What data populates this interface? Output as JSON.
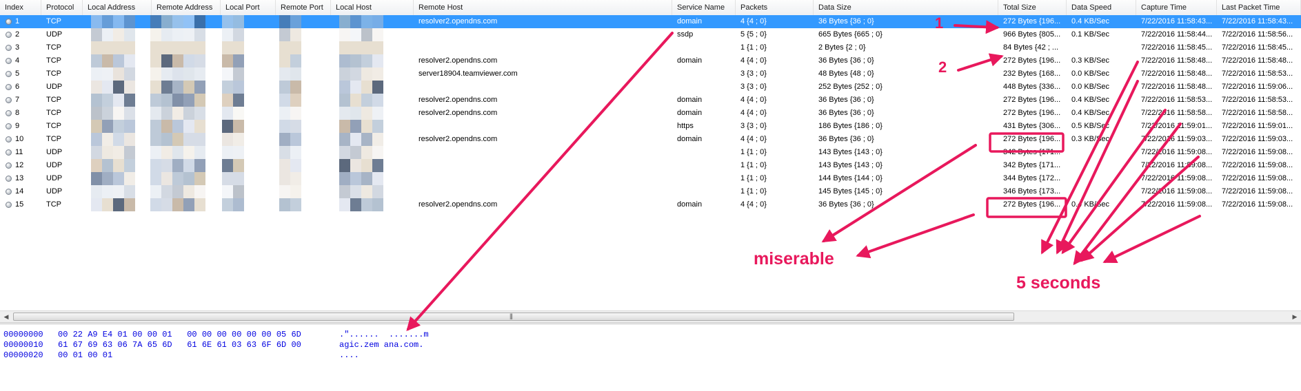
{
  "columns": [
    "Index",
    "Protocol",
    "Local Address",
    "Remote Address",
    "Local Port",
    "Remote Port",
    "Local Host",
    "Remote Host",
    "Service Name",
    "Packets",
    "Data Size",
    "Total Size",
    "Data Speed",
    "Capture Time",
    "Last Packet Time"
  ],
  "rows": [
    {
      "index": "1",
      "protocol": "TCP",
      "remote_host": "resolver2.opendns.com",
      "service": "domain",
      "packets": "4  {4 ; 0}",
      "data_size": "36 Bytes  {36 ; 0}",
      "total_size": "272 Bytes  {196...",
      "speed": "0.4 KB/Sec",
      "capture": "7/22/2016 11:58:43...",
      "last": "7/22/2016 11:58:43..."
    },
    {
      "index": "2",
      "protocol": "UDP",
      "remote_host": "",
      "service": "ssdp",
      "packets": "5  {5 ; 0}",
      "data_size": "665 Bytes  {665 ; 0}",
      "total_size": "966 Bytes  {805...",
      "speed": "0.1 KB/Sec",
      "capture": "7/22/2016 11:58:44...",
      "last": "7/22/2016 11:58:56..."
    },
    {
      "index": "3",
      "protocol": "TCP",
      "remote_host": "",
      "service": "",
      "packets": "1  {1 ; 0}",
      "data_size": "2 Bytes  {2 ; 0}",
      "total_size": "84 Bytes  {42 ; ...",
      "speed": "",
      "capture": "7/22/2016 11:58:45...",
      "last": "7/22/2016 11:58:45..."
    },
    {
      "index": "4",
      "protocol": "TCP",
      "remote_host": "resolver2.opendns.com",
      "service": "domain",
      "packets": "4  {4 ; 0}",
      "data_size": "36 Bytes  {36 ; 0}",
      "total_size": "272 Bytes  {196...",
      "speed": "0.3 KB/Sec",
      "capture": "7/22/2016 11:58:48...",
      "last": "7/22/2016 11:58:48..."
    },
    {
      "index": "5",
      "protocol": "TCP",
      "remote_host": "server18904.teamviewer.com",
      "service": "",
      "packets": "3  {3 ; 0}",
      "data_size": "48 Bytes  {48 ; 0}",
      "total_size": "232 Bytes  {168...",
      "speed": "0.0 KB/Sec",
      "capture": "7/22/2016 11:58:48...",
      "last": "7/22/2016 11:58:53..."
    },
    {
      "index": "6",
      "protocol": "UDP",
      "remote_host": "",
      "service": "",
      "packets": "3  {3 ; 0}",
      "data_size": "252 Bytes  {252 ; 0}",
      "total_size": "448 Bytes  {336...",
      "speed": "0.0 KB/Sec",
      "capture": "7/22/2016 11:58:48...",
      "last": "7/22/2016 11:59:06..."
    },
    {
      "index": "7",
      "protocol": "TCP",
      "remote_host": "resolver2.opendns.com",
      "service": "domain",
      "packets": "4  {4 ; 0}",
      "data_size": "36 Bytes  {36 ; 0}",
      "total_size": "272 Bytes  {196...",
      "speed": "0.4 KB/Sec",
      "capture": "7/22/2016 11:58:53...",
      "last": "7/22/2016 11:58:53..."
    },
    {
      "index": "8",
      "protocol": "TCP",
      "remote_host": "resolver2.opendns.com",
      "service": "domain",
      "packets": "4  {4 ; 0}",
      "data_size": "36 Bytes  {36 ; 0}",
      "total_size": "272 Bytes  {196...",
      "speed": "0.4 KB/Sec",
      "capture": "7/22/2016 11:58:58...",
      "last": "7/22/2016 11:58:58..."
    },
    {
      "index": "9",
      "protocol": "TCP",
      "remote_host": "",
      "service": "https",
      "packets": "3  {3 ; 0}",
      "data_size": "186 Bytes  {186 ; 0}",
      "total_size": "431 Bytes  {306...",
      "speed": "0.5 KB/Sec",
      "capture": "7/22/2016 11:59:01...",
      "last": "7/22/2016 11:59:01..."
    },
    {
      "index": "10",
      "protocol": "TCP",
      "remote_host": "resolver2.opendns.com",
      "service": "domain",
      "packets": "4  {4 ; 0}",
      "data_size": "36 Bytes  {36 ; 0}",
      "total_size": "272 Bytes  {196...",
      "speed": "0.3 KB/Sec",
      "capture": "7/22/2016 11:59:03...",
      "last": "7/22/2016 11:59:03..."
    },
    {
      "index": "11",
      "protocol": "UDP",
      "remote_host": "",
      "service": "",
      "packets": "1  {1 ; 0}",
      "data_size": "143 Bytes  {143 ; 0}",
      "total_size": "342 Bytes  {171...",
      "speed": "",
      "capture": "7/22/2016 11:59:08...",
      "last": "7/22/2016 11:59:08..."
    },
    {
      "index": "12",
      "protocol": "UDP",
      "remote_host": "",
      "service": "",
      "packets": "1  {1 ; 0}",
      "data_size": "143 Bytes  {143 ; 0}",
      "total_size": "342 Bytes  {171...",
      "speed": "",
      "capture": "7/22/2016 11:59:08...",
      "last": "7/22/2016 11:59:08..."
    },
    {
      "index": "13",
      "protocol": "UDP",
      "remote_host": "",
      "service": "",
      "packets": "1  {1 ; 0}",
      "data_size": "144 Bytes  {144 ; 0}",
      "total_size": "344 Bytes  {172...",
      "speed": "",
      "capture": "7/22/2016 11:59:08...",
      "last": "7/22/2016 11:59:08..."
    },
    {
      "index": "14",
      "protocol": "UDP",
      "remote_host": "",
      "service": "",
      "packets": "1  {1 ; 0}",
      "data_size": "145 Bytes  {145 ; 0}",
      "total_size": "346 Bytes  {173...",
      "speed": "",
      "capture": "7/22/2016 11:59:08...",
      "last": "7/22/2016 11:59:08..."
    },
    {
      "index": "15",
      "protocol": "TCP",
      "remote_host": "resolver2.opendns.com",
      "service": "domain",
      "packets": "4  {4 ; 0}",
      "data_size": "36 Bytes  {36 ; 0}",
      "total_size": "272 Bytes  {196...",
      "speed": "0.4 KB/Sec",
      "capture": "7/22/2016 11:59:08...",
      "last": "7/22/2016 11:59:08..."
    }
  ],
  "selected_row": "1",
  "scrollbar": {
    "grip": "|||"
  },
  "hex": {
    "lines": [
      {
        "offset": "00000000",
        "bytes": "00 22 A9 E4 01 00 00 01   00 00 00 00 00 00 05 6D",
        "ascii": ".\"......  .......m"
      },
      {
        "offset": "00000010",
        "bytes": "61 67 69 63 06 7A 65 6D   61 6E 61 03 63 6F 6D 00",
        "ascii": "agic.zem ana.com."
      },
      {
        "offset": "00000020",
        "bytes": "00 01 00 01",
        "ascii": "...."
      }
    ]
  },
  "annotations": {
    "one": "1",
    "two": "2",
    "miserable": "miserable",
    "five_seconds": "5 seconds"
  },
  "colors": {
    "selection": "#3399ff",
    "annotation": "#e8185c",
    "hex_text": "#0000e0"
  }
}
